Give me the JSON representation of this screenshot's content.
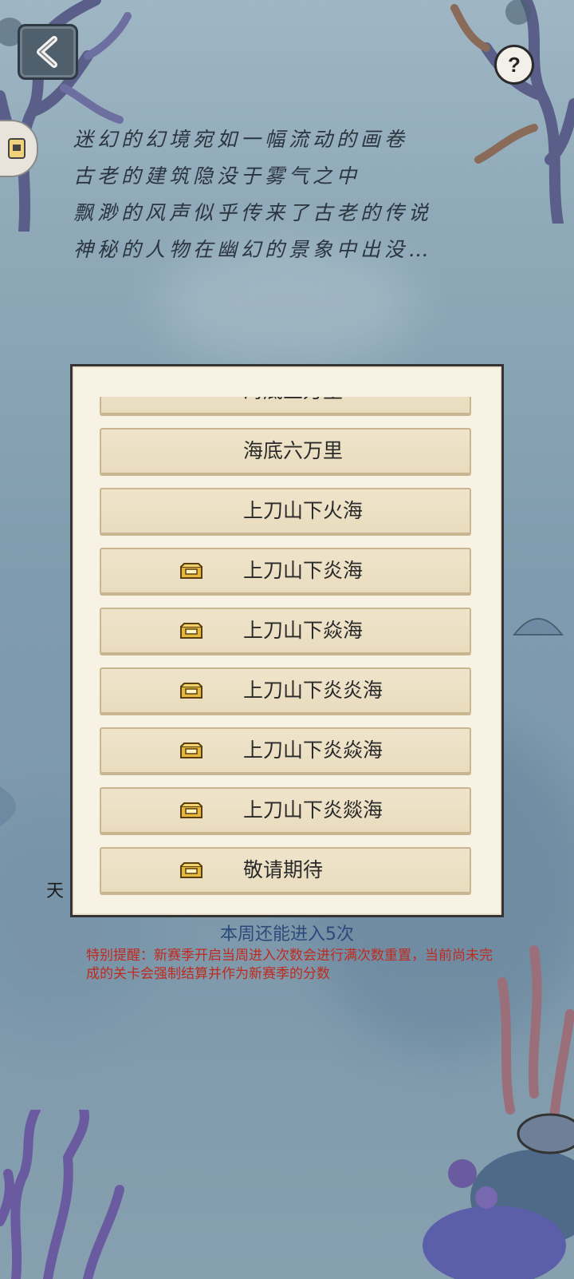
{
  "nav": {
    "back_icon": "chevron-left-icon",
    "help_label": "?",
    "side_icon": "scroll-icon"
  },
  "intro": {
    "lines": [
      "迷幻的幻境宛如一幅流动的画卷",
      "古老的建筑隐没于雾气之中",
      "飘渺的风声似乎传来了古老的传说",
      "神秘的人物在幽幻的景象中出没…"
    ]
  },
  "levels": [
    {
      "name": "海底五万里",
      "chest": false
    },
    {
      "name": "海底六万里",
      "chest": false
    },
    {
      "name": "上刀山下火海",
      "chest": false
    },
    {
      "name": "上刀山下炎海",
      "chest": true
    },
    {
      "name": "上刀山下焱海",
      "chest": true
    },
    {
      "name": "上刀山下炎炎海",
      "chest": true
    },
    {
      "name": "上刀山下炎焱海",
      "chest": true
    },
    {
      "name": "上刀山下炎燚海",
      "chest": true
    },
    {
      "name": "敬请期待",
      "chest": true
    }
  ],
  "footer": {
    "weekly_entries": "本周还能进入5次",
    "notice": "特别提醒：新赛季开启当周进入次数会进行满次数重置，当前尚未完成的关卡会强制结算并作为新赛季的分数"
  },
  "background": {
    "partial_label": "天"
  },
  "colors": {
    "panel_bg": "#f7f2e3",
    "button_bg": "#efe4cb",
    "notice_red": "#c02a1e",
    "weekly_blue": "#2b4a7a",
    "chest_gold": "#e0b23a"
  }
}
